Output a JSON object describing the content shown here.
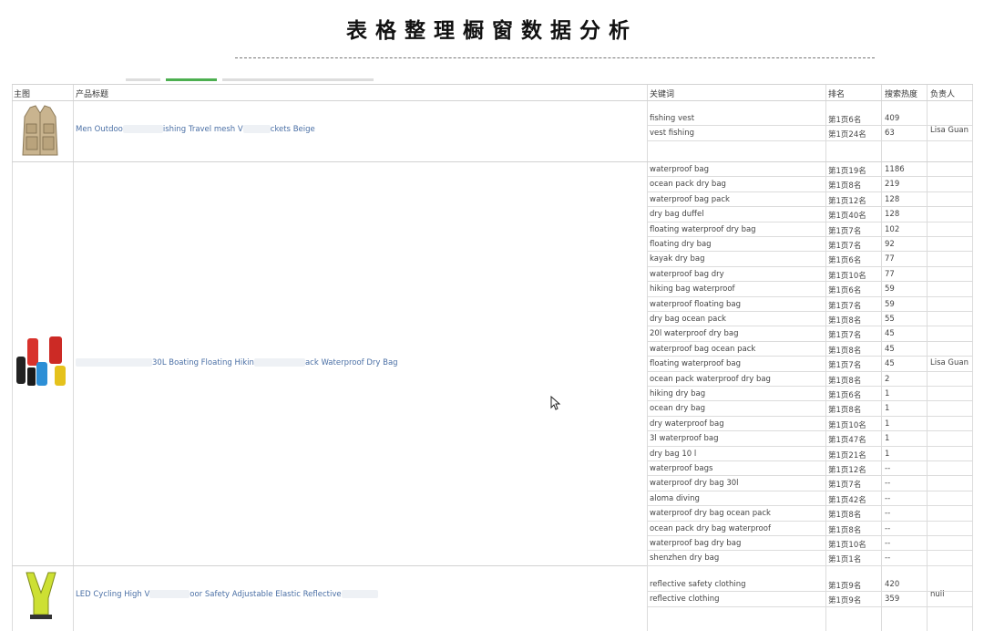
{
  "page_title": "表格整理橱窗数据分析",
  "table": {
    "headers": [
      "主图",
      "产品标题",
      "关键词",
      "排名",
      "搜索热度",
      "负责人"
    ],
    "products": [
      {
        "image_icon": "fishing-vest-icon",
        "title_left": "Men Outdoo",
        "title_mid": "ishing Travel mesh V",
        "title_right": "ckets Beige",
        "owner": "Lisa Guan",
        "keywords": [
          {
            "keyword": "fishing vest",
            "rank": "第1页6名",
            "heat": "409"
          },
          {
            "keyword": "vest fishing",
            "rank": "第1页24名",
            "heat": "63"
          }
        ]
      },
      {
        "image_icon": "dry-bag-icon",
        "title_left": "",
        "title_mid": "30L Boating Floating Hikin",
        "title_right": "ack Waterproof Dry Bag",
        "owner": "Lisa Guan",
        "keywords": [
          {
            "keyword": "waterproof bag",
            "rank": "第1页19名",
            "heat": "1186"
          },
          {
            "keyword": "ocean pack dry bag",
            "rank": "第1页8名",
            "heat": "219"
          },
          {
            "keyword": "waterproof bag pack",
            "rank": "第1页12名",
            "heat": "128"
          },
          {
            "keyword": "dry bag duffel",
            "rank": "第1页40名",
            "heat": "128"
          },
          {
            "keyword": "floating waterproof dry bag",
            "rank": "第1页7名",
            "heat": "102"
          },
          {
            "keyword": "floating dry bag",
            "rank": "第1页7名",
            "heat": "92"
          },
          {
            "keyword": "kayak dry bag",
            "rank": "第1页6名",
            "heat": "77"
          },
          {
            "keyword": "waterproof bag dry",
            "rank": "第1页10名",
            "heat": "77"
          },
          {
            "keyword": "hiking bag waterproof",
            "rank": "第1页6名",
            "heat": "59"
          },
          {
            "keyword": "waterproof floating bag",
            "rank": "第1页7名",
            "heat": "59"
          },
          {
            "keyword": "dry bag ocean pack",
            "rank": "第1页8名",
            "heat": "55"
          },
          {
            "keyword": "20l waterproof dry bag",
            "rank": "第1页7名",
            "heat": "45"
          },
          {
            "keyword": "waterproof bag ocean pack",
            "rank": "第1页8名",
            "heat": "45"
          },
          {
            "keyword": "floating waterproof bag",
            "rank": "第1页7名",
            "heat": "45"
          },
          {
            "keyword": "ocean pack waterproof dry bag",
            "rank": "第1页8名",
            "heat": "2"
          },
          {
            "keyword": "hiking dry bag",
            "rank": "第1页6名",
            "heat": "1"
          },
          {
            "keyword": "ocean dry bag",
            "rank": "第1页8名",
            "heat": "1"
          },
          {
            "keyword": "dry waterproof bag",
            "rank": "第1页10名",
            "heat": "1"
          },
          {
            "keyword": "3l waterproof bag",
            "rank": "第1页47名",
            "heat": "1"
          },
          {
            "keyword": "dry bag 10 l",
            "rank": "第1页21名",
            "heat": "1"
          },
          {
            "keyword": "waterproof bags",
            "rank": "第1页12名",
            "heat": "--"
          },
          {
            "keyword": "waterproof dry bag 30l",
            "rank": "第1页7名",
            "heat": "--"
          },
          {
            "keyword": "aloma diving",
            "rank": "第1页42名",
            "heat": "--"
          },
          {
            "keyword": "waterproof dry bag ocean pack",
            "rank": "第1页8名",
            "heat": "--"
          },
          {
            "keyword": "ocean pack dry bag waterproof",
            "rank": "第1页8名",
            "heat": "--"
          },
          {
            "keyword": "waterproof bag dry bag",
            "rank": "第1页10名",
            "heat": "--"
          },
          {
            "keyword": "shenzhen dry bag",
            "rank": "第1页1名",
            "heat": "--"
          }
        ]
      },
      {
        "image_icon": "reflective-vest-icon",
        "title_left": "LED Cycling High V",
        "title_mid": "oor Safety Adjustable Elastic Reflective",
        "title_right": "",
        "owner": "null",
        "keywords": [
          {
            "keyword": "reflective safety clothing",
            "rank": "第1页9名",
            "heat": "420"
          },
          {
            "keyword": "reflective clothing",
            "rank": "第1页9名",
            "heat": "359"
          }
        ]
      }
    ]
  }
}
